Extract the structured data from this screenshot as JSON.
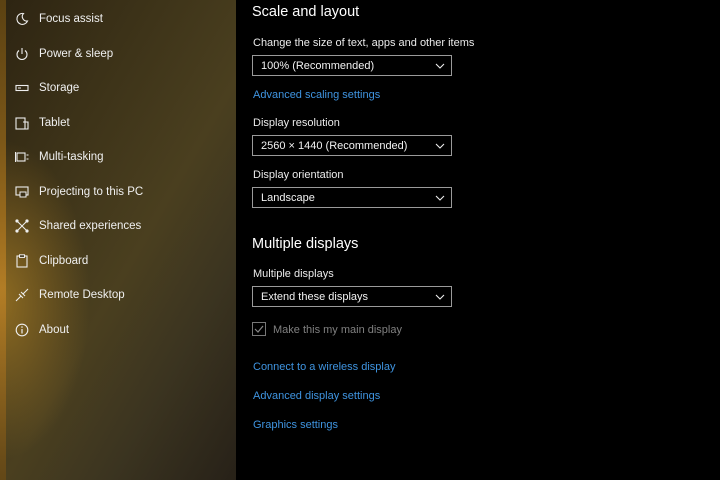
{
  "sidebar": {
    "items": [
      {
        "label": "Focus assist",
        "icon": "moon-icon"
      },
      {
        "label": "Power & sleep",
        "icon": "power-icon"
      },
      {
        "label": "Storage",
        "icon": "storage-icon"
      },
      {
        "label": "Tablet",
        "icon": "tablet-icon"
      },
      {
        "label": "Multi-tasking",
        "icon": "multitasking-icon"
      },
      {
        "label": "Projecting to this PC",
        "icon": "projecting-icon"
      },
      {
        "label": "Shared experiences",
        "icon": "shared-experiences-icon"
      },
      {
        "label": "Clipboard",
        "icon": "clipboard-icon"
      },
      {
        "label": "Remote Desktop",
        "icon": "remote-desktop-icon"
      },
      {
        "label": "About",
        "icon": "info-icon"
      }
    ]
  },
  "scale_layout": {
    "heading": "Scale and layout",
    "text_size_label": "Change the size of text, apps and other items",
    "text_size_value": "100% (Recommended)",
    "advanced_scaling_link": "Advanced scaling settings",
    "resolution_label": "Display resolution",
    "resolution_value": "2560 × 1440 (Recommended)",
    "orientation_label": "Display orientation",
    "orientation_value": "Landscape"
  },
  "multiple_displays": {
    "heading": "Multiple displays",
    "label": "Multiple displays",
    "value": "Extend these displays",
    "main_display_label": "Make this my main display",
    "main_display_checked": true,
    "main_display_enabled": false
  },
  "links": {
    "wireless": "Connect to a wireless display",
    "advanced_display": "Advanced display settings",
    "graphics": "Graphics settings"
  },
  "colors": {
    "accent_link": "#3f94e0",
    "background": "#000000"
  }
}
